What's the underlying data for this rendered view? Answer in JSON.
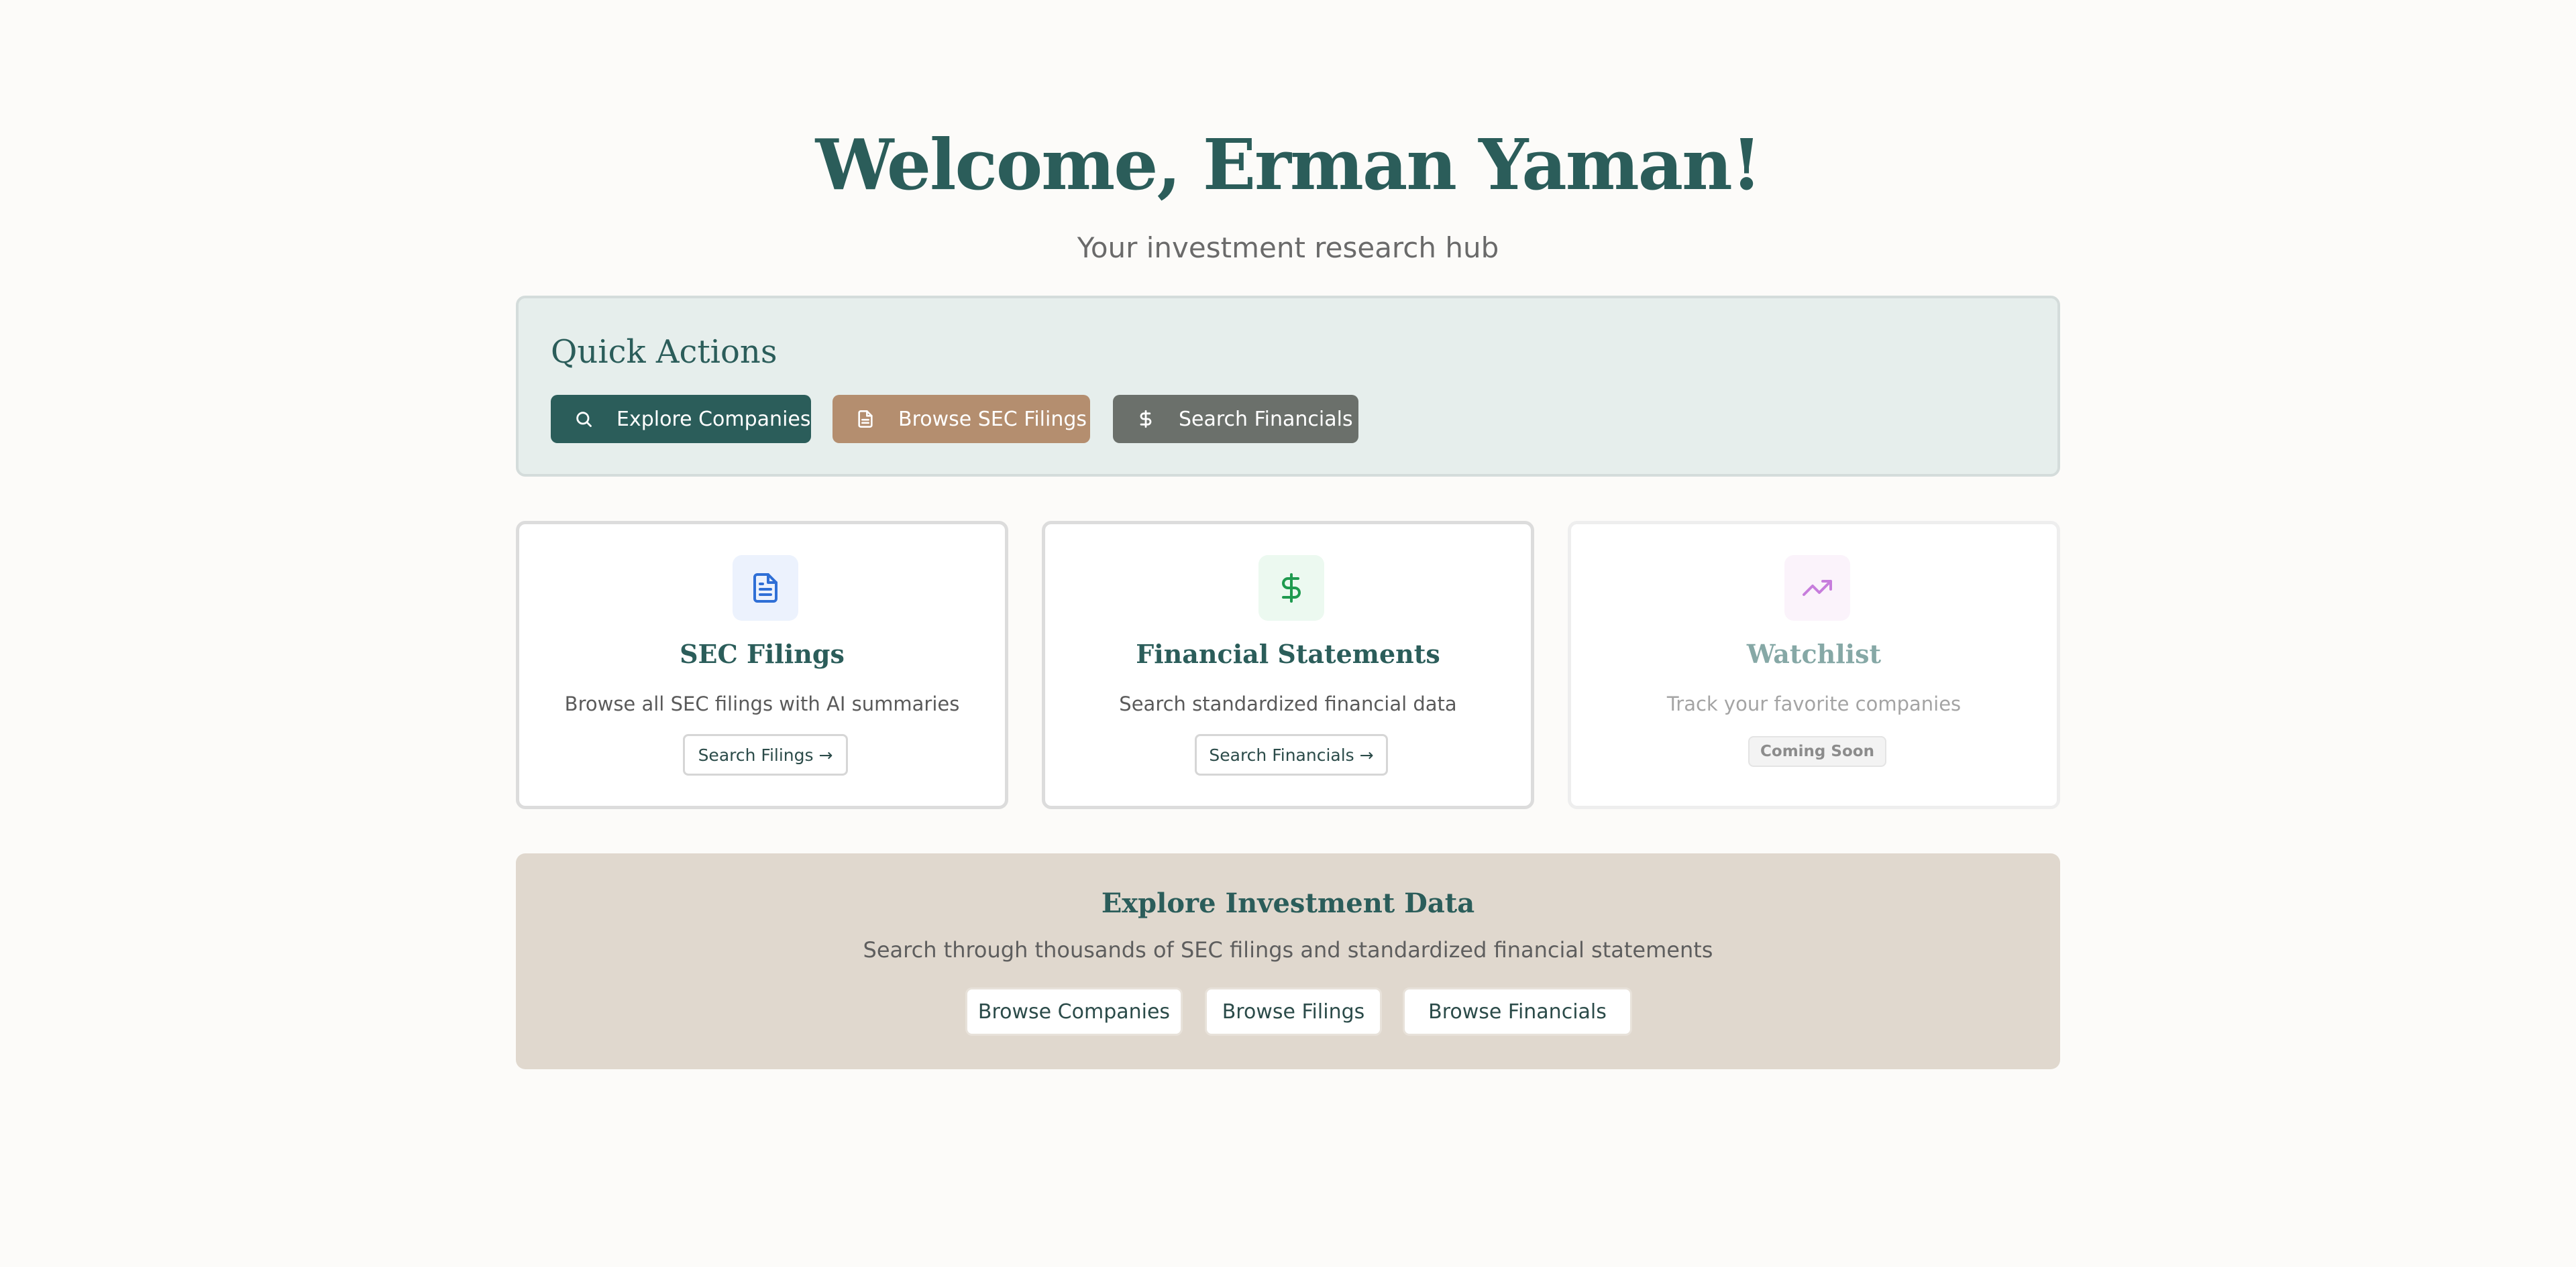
{
  "hero": {
    "title": "Welcome, Erman Yaman!",
    "subtitle": "Your investment research hub"
  },
  "quick_actions": {
    "title": "Quick Actions",
    "buttons": [
      {
        "label": "Explore Companies",
        "icon": "search-icon",
        "color": "#2b5d5a"
      },
      {
        "label": "Browse SEC Filings",
        "icon": "document-icon",
        "color": "#b48e6f"
      },
      {
        "label": "Search Financials",
        "icon": "dollar-icon",
        "color": "#6b706b"
      }
    ]
  },
  "cards": [
    {
      "title": "SEC Filings",
      "description": "Browse all SEC filings with AI summaries",
      "button": "Search Filings →",
      "icon": "document-icon",
      "icon_color": "#2f6fd6"
    },
    {
      "title": "Financial Statements",
      "description": "Search standardized financial data",
      "button": "Search Financials →",
      "icon": "dollar-icon",
      "icon_color": "#1f9a4f"
    },
    {
      "title": "Watchlist",
      "description": "Track your favorite companies",
      "badge": "Coming Soon",
      "icon": "trending-up-icon",
      "icon_color": "#c77ddc"
    }
  ],
  "explore": {
    "title": "Explore Investment Data",
    "subtitle": "Search through thousands of SEC filings and standardized financial statements",
    "buttons": [
      "Browse Companies",
      "Browse Filings",
      "Browse Financials"
    ]
  }
}
